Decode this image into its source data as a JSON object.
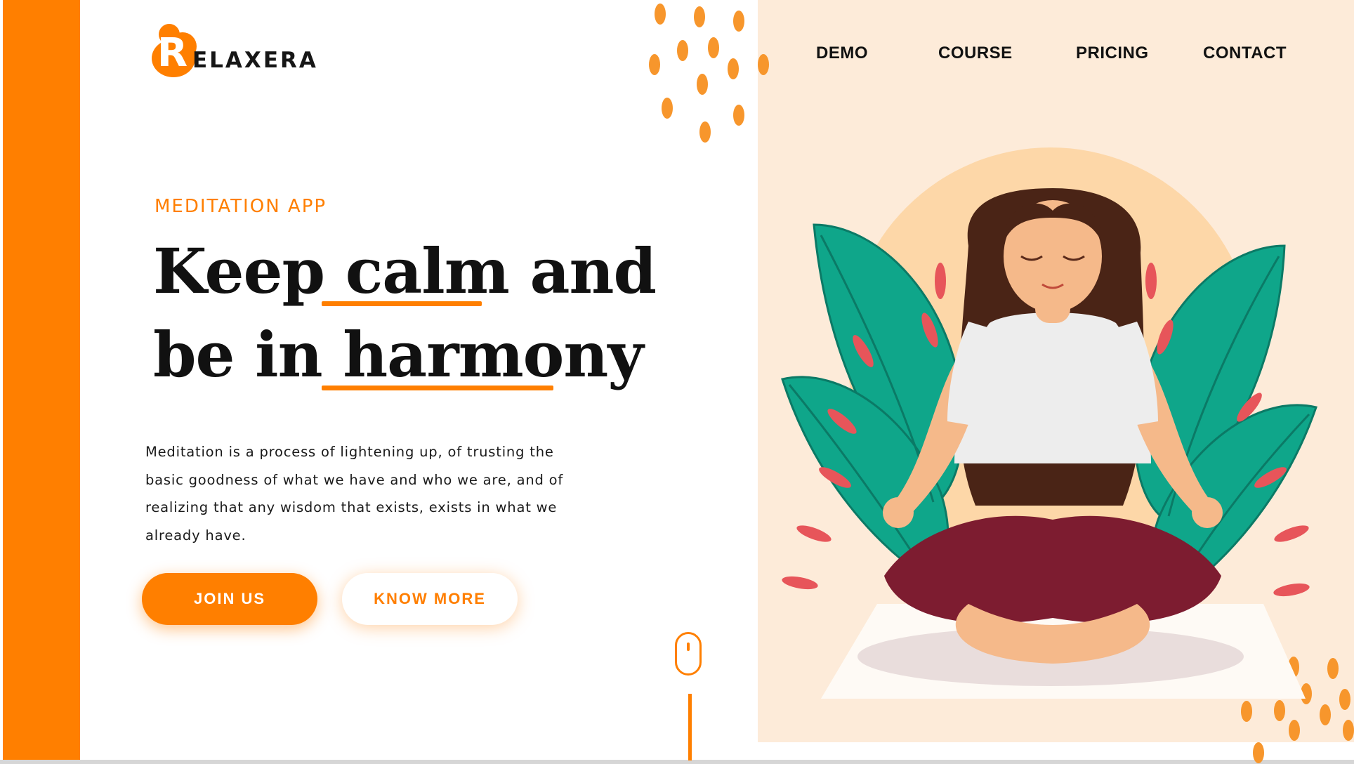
{
  "brand": {
    "logo_letter": "R",
    "logo_text": "ELAXERA",
    "accent_color": "#ff7f00",
    "panel_color": "#fdebd9"
  },
  "nav": {
    "items": [
      {
        "label": "DEMO"
      },
      {
        "label": "COURSE"
      },
      {
        "label": "PRICING"
      },
      {
        "label": "CONTACT"
      }
    ]
  },
  "hero": {
    "eyebrow": "MEDITATION APP",
    "headline_line1_a": "Keep ",
    "headline_line1_b": "calm",
    "headline_line1_c": " and",
    "headline_line2_a": "be in ",
    "headline_line2_b": "harmony",
    "description": "Meditation is a process of lightening up, of trusting the basic goodness of what we have and who we are, and of realizing that any wisdom that exists, exists in what we already have."
  },
  "buttons": {
    "join_label": "JOIN US",
    "know_more_label": "KNOW MORE"
  },
  "icons": {
    "scroll": "mouse-scroll-icon"
  }
}
